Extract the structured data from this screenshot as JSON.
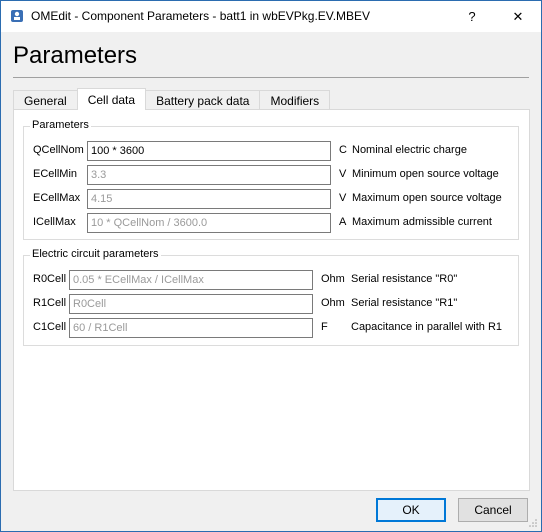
{
  "window": {
    "title": "OMEdit - Component Parameters - batt1 in wbEVPkg.EV.MBEV",
    "help_glyph": "?",
    "close_glyph": "✕"
  },
  "heading": "Parameters",
  "tabs": [
    {
      "label": "General",
      "active": false
    },
    {
      "label": "Cell data",
      "active": true
    },
    {
      "label": "Battery pack data",
      "active": false
    },
    {
      "label": "Modifiers",
      "active": false
    }
  ],
  "groups": {
    "parameters": {
      "title": "Parameters",
      "rows": [
        {
          "name": "QCellNom",
          "value": "100 * 3600",
          "unit": "C",
          "description": "Nominal electric charge"
        },
        {
          "name": "ECellMin",
          "value": "3.3",
          "unit": "V",
          "description": "Minimum open source voltage"
        },
        {
          "name": "ECellMax",
          "value": "4.15",
          "unit": "V",
          "description": "Maximum open source voltage"
        },
        {
          "name": "ICellMax",
          "value": "10 * QCellNom / 3600.0",
          "unit": "A",
          "description": "Maximum admissible current"
        }
      ]
    },
    "electric": {
      "title": "Electric circuit parameters",
      "rows": [
        {
          "name": "R0Cell",
          "value": "0.05 * ECellMax / ICellMax",
          "unit": "Ohm",
          "description": "Serial resistance \"R0\""
        },
        {
          "name": "R1Cell",
          "value": "R0Cell",
          "unit": "Ohm",
          "description": "Serial resistance \"R1\""
        },
        {
          "name": "C1Cell",
          "value": "60 / R1Cell",
          "unit": "F",
          "description": "Capacitance in parallel with R1"
        }
      ]
    }
  },
  "buttons": {
    "ok": "OK",
    "cancel": "Cancel"
  },
  "colors": {
    "accent": "#0078d7",
    "window_border": "#2b6cb0"
  }
}
